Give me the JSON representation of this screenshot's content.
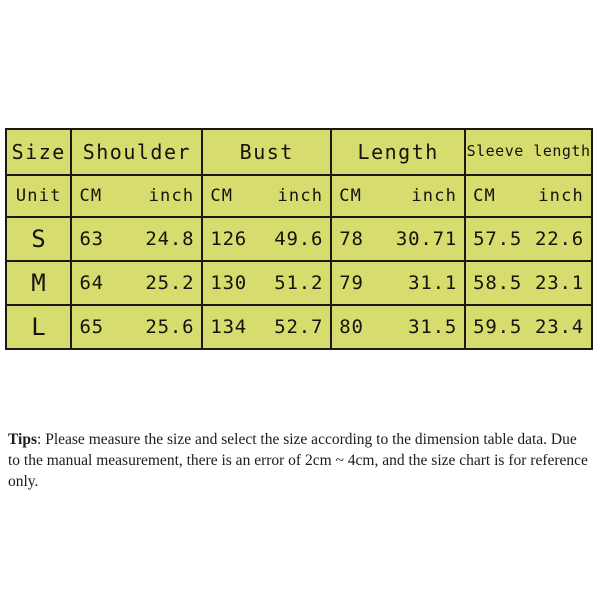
{
  "table": {
    "group_headers": [
      {
        "label": "Size",
        "two_line": false
      },
      {
        "label": "Shoulder",
        "two_line": false
      },
      {
        "label": "Bust",
        "two_line": false
      },
      {
        "label": "Length",
        "two_line": false
      },
      {
        "label": "Sleeve length",
        "two_line": true
      }
    ],
    "unit_row": {
      "label": "Unit",
      "cm": "CM",
      "inch": "inch"
    },
    "rows": [
      {
        "size": "S",
        "shoulder_cm": "63",
        "shoulder_inch": "24.8",
        "bust_cm": "126",
        "bust_inch": "49.6",
        "length_cm": "78",
        "length_inch": "30.71",
        "sleeve_cm": "57.5",
        "sleeve_inch": "22.6"
      },
      {
        "size": "M",
        "shoulder_cm": "64",
        "shoulder_inch": "25.2",
        "bust_cm": "130",
        "bust_inch": "51.2",
        "length_cm": "79",
        "length_inch": "31.1",
        "sleeve_cm": "58.5",
        "sleeve_inch": "23.1"
      },
      {
        "size": "L",
        "shoulder_cm": "65",
        "shoulder_inch": "25.6",
        "bust_cm": "134",
        "bust_inch": "52.7",
        "length_cm": "80",
        "length_inch": "31.5",
        "sleeve_cm": "59.5",
        "sleeve_inch": "23.4"
      }
    ],
    "colors": {
      "cell_background": "#d6dc6e",
      "border": "#1a1a14",
      "text": "#14140d"
    }
  },
  "tips": {
    "prefix": "Tips",
    "separator": ": ",
    "body": "Please measure the size and select the size according to the dimension table data. Due to the manual measurement, there is an error of 2cm ~ 4cm, and the size chart is for reference only."
  }
}
